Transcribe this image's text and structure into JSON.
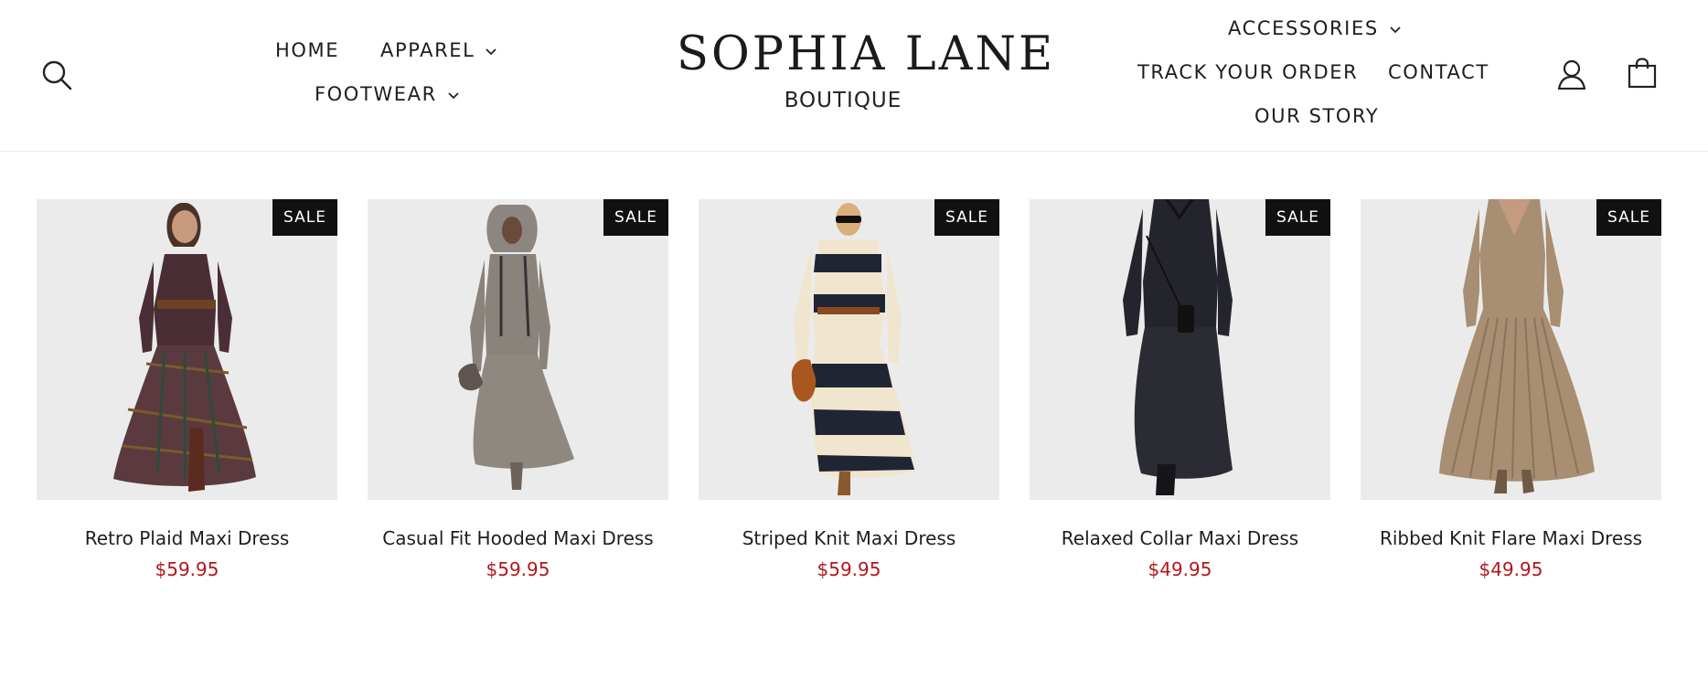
{
  "brand": {
    "name": "SOPHIA LANE",
    "subtitle": "BOUTIQUE"
  },
  "nav_left": [
    {
      "label": "HOME",
      "dropdown": false
    },
    {
      "label": "APPAREL",
      "dropdown": true
    },
    {
      "label": "FOOTWEAR",
      "dropdown": true
    }
  ],
  "nav_right": [
    {
      "label": "ACCESSORIES",
      "dropdown": true
    },
    {
      "label": "TRACK YOUR ORDER",
      "dropdown": false
    },
    {
      "label": "CONTACT",
      "dropdown": false
    },
    {
      "label": "OUR STORY",
      "dropdown": false
    }
  ],
  "icons": {
    "search": "search-icon",
    "account": "user-icon",
    "cart": "shopping-bag-icon",
    "chevron": "chevron-down-icon"
  },
  "colors": {
    "price": "#b3171c",
    "badge_bg": "#111111",
    "image_bg": "#ebebeb"
  },
  "products": [
    {
      "title": "Retro Plaid Maxi Dress",
      "price": "$59.95",
      "badge": "SALE",
      "image": "plaid-maxi-dress-photo"
    },
    {
      "title": "Casual Fit Hooded Maxi Dress",
      "price": "$59.95",
      "badge": "SALE",
      "image": "hooded-maxi-dress-photo"
    },
    {
      "title": "Striped Knit Maxi Dress",
      "price": "$59.95",
      "badge": "SALE",
      "image": "striped-knit-dress-photo"
    },
    {
      "title": "Relaxed Collar Maxi Dress",
      "price": "$49.95",
      "badge": "SALE",
      "image": "collar-maxi-dress-photo"
    },
    {
      "title": "Ribbed Knit Flare Maxi Dress",
      "price": "$49.95",
      "badge": "SALE",
      "image": "ribbed-flare-dress-photo"
    }
  ]
}
